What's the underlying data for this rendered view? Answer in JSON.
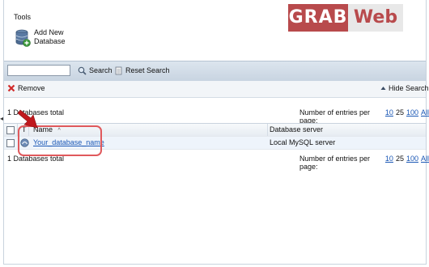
{
  "tools": {
    "title": "Tools",
    "add_database": {
      "line1": "Add New",
      "line2": "Database",
      "icon": "database-add-icon"
    }
  },
  "watermark": {
    "part1": "GRAB",
    "part2": "Web"
  },
  "search": {
    "input_value": "",
    "input_placeholder": "",
    "search_label": "Search",
    "reset_label": "Reset Search"
  },
  "actions": {
    "remove_label": "Remove",
    "hide_search_label": "Hide Search"
  },
  "listing": {
    "total_text": "1 Databases total",
    "pager_label": "Number of entries per page:",
    "page_sizes": [
      "10",
      "25",
      "100",
      "All"
    ],
    "current_page_size": "25",
    "columns": {
      "type": "T",
      "name": "Name",
      "sort_indicator": "^",
      "server": "Database server"
    },
    "rows": [
      {
        "name": "Your_database_name",
        "server": "Local MySQL server"
      }
    ]
  },
  "colors": {
    "accent_red": "#e0595c",
    "link_blue": "#1a57b5",
    "toolbar_blue": "#c8d4e1"
  }
}
